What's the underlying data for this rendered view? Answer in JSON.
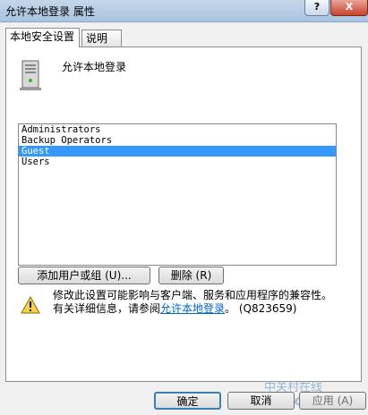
{
  "window": {
    "title": "允许本地登录 属性",
    "help_glyph": "?",
    "close_glyph": "X"
  },
  "tabs": [
    {
      "label": "本地安全设置",
      "active": true
    },
    {
      "label": "说明",
      "active": false
    }
  ],
  "setting": {
    "icon": "server-icon",
    "name": "允许本地登录"
  },
  "principals": {
    "items": [
      "Administrators",
      "Backup Operators",
      "Guest",
      "Users"
    ],
    "selected_index": 2
  },
  "actions": {
    "add_label": "添加用户或组 (U)...",
    "remove_label": "删除 (R)"
  },
  "warning": {
    "icon": "warning-icon",
    "line1": "修改此设置可能影响与客户端、服务和应用程序的兼容性。",
    "line2_prefix": "有关详细信息，请参阅",
    "link_text": "允许本地登录",
    "line2_suffix": "。 (Q823659)"
  },
  "footer": {
    "ok_label": "确定",
    "cancel_label": "取消",
    "apply_label": "应用 (A)"
  },
  "watermark": {
    "line1": "中关村在线",
    "line2": "zol.com.cn"
  },
  "colors": {
    "selection": "#3399ff",
    "link": "#0066cc"
  }
}
